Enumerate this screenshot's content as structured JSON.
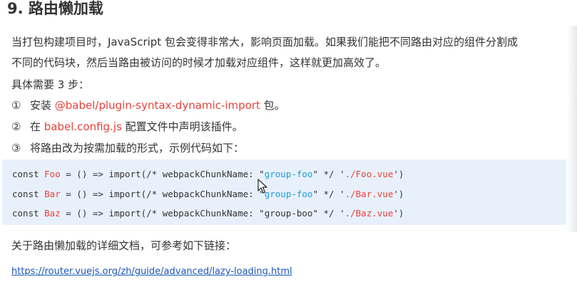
{
  "heading": "9. 路由懒加载",
  "intro_line1": "当打包构建项目时，JavaScript 包会变得非常大，影响页面加载。如果我们能把不同路由对应的组件分割成",
  "intro_line2": "不同的代码块，然后当路由被访问的时候才加载对应组件，这样就更加高效了。",
  "steps_intro": "具体需要 3 步：",
  "steps": [
    {
      "marker": "①",
      "before": "安装 ",
      "highlight": "@babel/plugin-syntax-dynamic-import",
      "after": " 包。"
    },
    {
      "marker": "②",
      "before": "在 ",
      "highlight": "babel.config.js",
      "after": " 配置文件中声明该插件。"
    },
    {
      "marker": "③",
      "before": "将路由改为按需加载的形式，示例代码如下：",
      "highlight": "",
      "after": ""
    }
  ],
  "code": [
    {
      "kw": "const ",
      "id": "Foo",
      "mid": " = () => import(/* webpackChunkName: \"",
      "str": "group-foo",
      "mid2": "\" */ '",
      "path": "./Foo.vue",
      "end": "')"
    },
    {
      "kw": "const ",
      "id": "Bar",
      "mid": " = () => import(/* webpackChunkName: \"",
      "str": "group-foo",
      "mid2": "\" */ '",
      "path": "./Bar.vue",
      "end": "')"
    },
    {
      "kw": "const ",
      "id": "Baz",
      "mid": " = () => import(/* webpackChunkName: \"",
      "str": "group-boo",
      "mid2": "\" */ '",
      "path": "./Baz.vue",
      "end": "')"
    }
  ],
  "link_intro": "关于路由懒加载的详细文档，可参考如下链接：",
  "link_text": "https://router.vuejs.org/zh/guide/advanced/lazy-loading.html",
  "colors": {
    "highlight": "#e8413a",
    "code_string": "#1c9bd9",
    "code_background": "#e8f1fb",
    "link": "#1a56b7"
  },
  "icons": [
    "mouse-cursor-icon"
  ]
}
